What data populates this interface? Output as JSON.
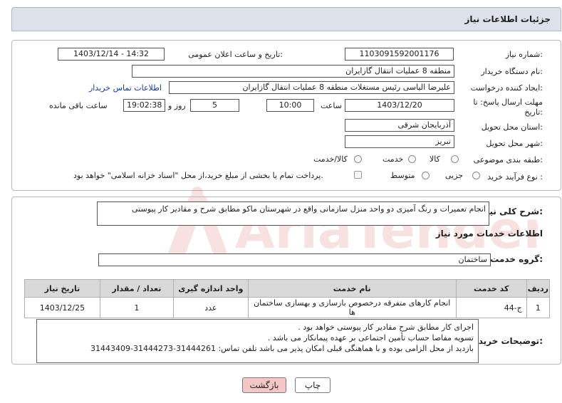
{
  "header": {
    "title": "جزئیات اطلاعات نیاز"
  },
  "form": {
    "need_number_label": "شماره نیاز:",
    "need_number": "1103091592001176",
    "announce_label": "تاریخ و ساعت اعلان عمومی:",
    "announce_value": "1403/12/14 - 14:32",
    "buyer_org_label": "نام دستگاه خریدار:",
    "buyer_org": "منطقه 8 عملیات انتقال گازایران",
    "creator_label": "ایجاد کننده درخواست:",
    "creator": "علیرضا الیاسی رئیس مستغلات منطقه 8 عملیات انتقال گازایران",
    "contact_link": "اطلاعات تماس خریدار",
    "deadline_label_1": "مهلت ارسال پاسخ: تا",
    "deadline_label_2": "تاریخ:",
    "deadline_date": "1403/12/20",
    "time_label": "ساعت",
    "deadline_time": "10:00",
    "days": "5",
    "days_label": "روز و",
    "remaining": "19:02:38",
    "remaining_label": "ساعت باقی مانده",
    "province_label": "استان محل تحویل:",
    "province": "آذربایجان شرقی",
    "city_label": "شهر محل تحویل:",
    "city": "تبریز",
    "category_label": "طبقه بندی موضوعی:",
    "category_options": [
      "کالا",
      "خدمت",
      "کالا/خدمت"
    ],
    "process_label": "نوع فرآیند خرید :",
    "process_options": [
      "جزیی",
      "متوسط"
    ],
    "payment_note": "پرداخت تمام یا بخشی از مبلغ خرید،از محل \"اسناد خزانه اسلامی\" خواهد بود."
  },
  "summary": {
    "label": "شرح کلی نیاز:",
    "text": "انجام تعمیرات و رنگ آمیزی دو واحد منزل سازمانی  واقع در شهرستان ماکو مطابق شرح و مقادیر کار پیوستی"
  },
  "services": {
    "section_title": "اطلاعات خدمات مورد نیاز",
    "group_label": "گروه خدمت:",
    "group_value": "ساختمان",
    "columns": [
      "ردیف",
      "کد خدمت",
      "نام خدمت",
      "واحد اندازه گیری",
      "تعداد / مقدار",
      "تاریخ نیاز"
    ],
    "rows": [
      {
        "row": "1",
        "code": "ج-44",
        "name": "انجام کارهای متفرقه درخصوص بازسازی و بهسازی ساختمان ها",
        "unit": "عدد",
        "qty": "1",
        "date": "1403/12/25"
      }
    ]
  },
  "buyer_notes": {
    "label": "توضیحات خریدار:",
    "lines": [
      "اجرای کار مطابق شرح  مقادیر کار پیوستی خواهد بود .",
      "تسویه مفاصا حساب تأمین اجتماعی بر عهده پیمانکار می باشد .",
      "بازدید از محل الزامی بوده و با هماهنگی قبلی امکان پذیر می باشد تلفن تماس: 31444261-31444273-31443409"
    ]
  },
  "buttons": {
    "print": "چاپ",
    "back": "بازگشت"
  },
  "watermark": {
    "text": "AriaTender.net"
  },
  "colors": {
    "title_bar": "#dde2ea",
    "table_header": "#d9d9d9",
    "link": "#1a3a9a",
    "back_button": "#f4c6c6",
    "watermark": "#d43c3c"
  }
}
